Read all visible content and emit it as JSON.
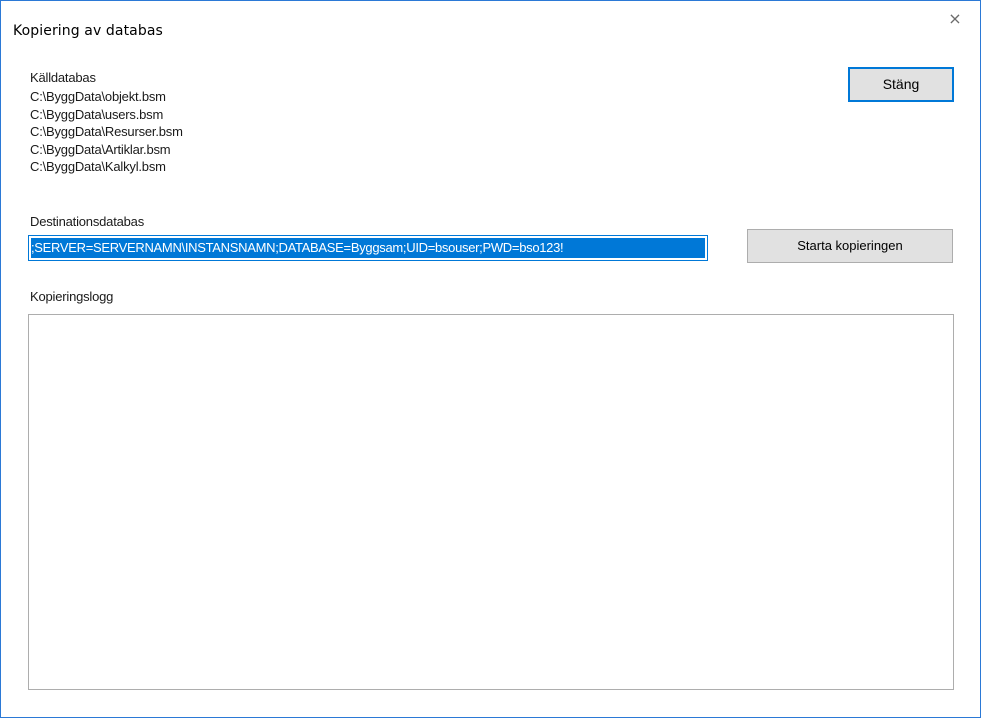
{
  "window": {
    "title": "Kopiering av databas",
    "close_glyph": "×"
  },
  "source": {
    "label": "Källdatabas",
    "files": [
      "C:\\ByggData\\objekt.bsm",
      "C:\\ByggData\\users.bsm",
      "C:\\ByggData\\Resurser.bsm",
      "C:\\ByggData\\Artiklar.bsm",
      "C:\\ByggData\\Kalkyl.bsm"
    ]
  },
  "buttons": {
    "close_label": "Stäng",
    "start_label": "Starta kopieringen"
  },
  "destination": {
    "label": "Destinationsdatabas",
    "value": ";SERVER=SERVERNAMN\\INSTANSNAMN;DATABASE=Byggsam;UID=bsouser;PWD=bso123!"
  },
  "log": {
    "label": "Kopieringslogg",
    "content": ""
  },
  "colors": {
    "accent": "#0078d7",
    "window_border": "#2b79d6"
  }
}
